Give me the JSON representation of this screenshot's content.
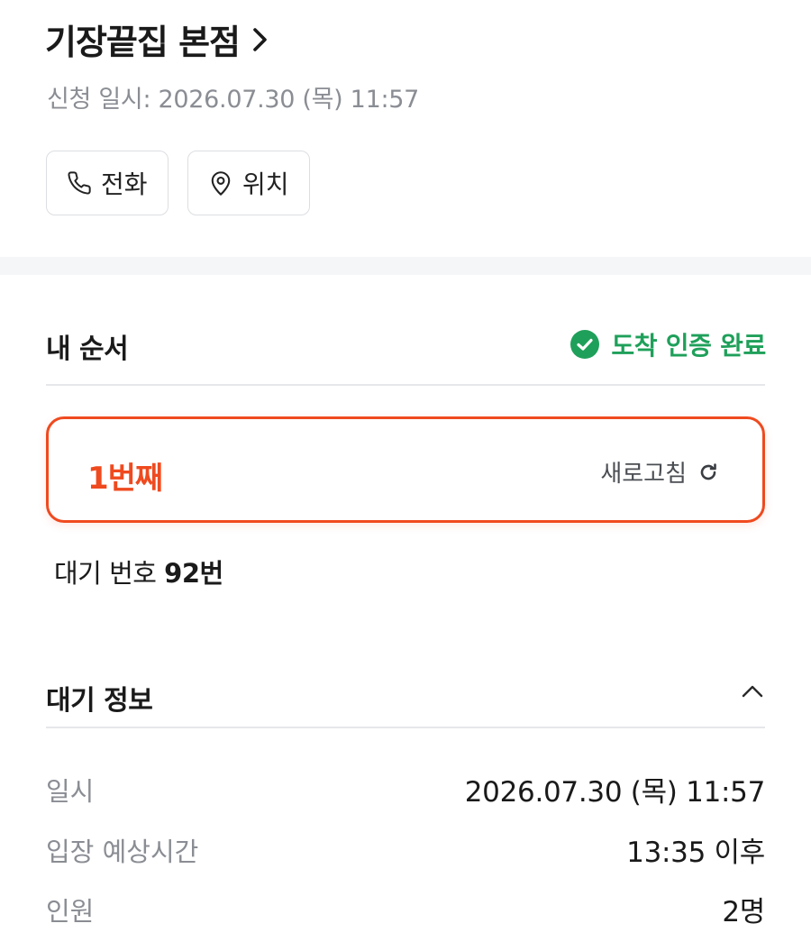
{
  "store": {
    "name": "기장끝집 본점",
    "applied_at": "신청 일시: 2026.07.30 (목) 11:57"
  },
  "actions": {
    "call_label": "전화",
    "location_label": "위치"
  },
  "my_order": {
    "title": "내 순서",
    "arrival_status": "도착 인증 완료",
    "rank": "1번째",
    "refresh_label": "새로고침",
    "waiting_label": "대기 번호",
    "waiting_number": "92번"
  },
  "wait_info": {
    "title": "대기 정보",
    "rows": [
      {
        "label": "일시",
        "value": "2026.07.30 (목) 11:57"
      },
      {
        "label": "입장 예상시간",
        "value": "13:35 이후"
      },
      {
        "label": "인원",
        "value": "2명"
      }
    ]
  },
  "colors": {
    "accent": "#ef4a1f",
    "success": "#1fa05a",
    "muted_text": "#8a8d93",
    "border": "#dcdee2"
  },
  "icons": [
    "chevron-right-icon",
    "phone-icon",
    "map-pin-icon",
    "check-circle-icon",
    "refresh-icon",
    "chevron-up-icon"
  ]
}
